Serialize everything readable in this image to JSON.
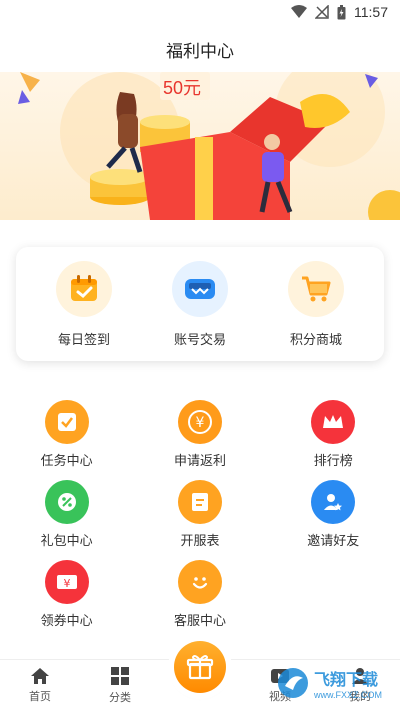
{
  "status_bar": {
    "time": "11:57"
  },
  "header": {
    "title": "福利中心"
  },
  "banner": {
    "tag_text": "50元"
  },
  "features": [
    {
      "label": "每日签到",
      "icon": "calendar-check-icon"
    },
    {
      "label": "账号交易",
      "icon": "account-trade-icon"
    },
    {
      "label": "积分商城",
      "icon": "shopping-cart-icon"
    }
  ],
  "grid": [
    {
      "label": "任务中心",
      "icon": "task-check-icon",
      "color": "#ffa321"
    },
    {
      "label": "申请返利",
      "icon": "yen-coin-icon",
      "color": "#ff9b1a"
    },
    {
      "label": "排行榜",
      "icon": "crown-icon",
      "color": "#f5333b"
    },
    {
      "label": "礼包中心",
      "icon": "gift-percent-icon",
      "color": "#39c35a"
    },
    {
      "label": "开服表",
      "icon": "server-list-icon",
      "color": "#ffa321"
    },
    {
      "label": "邀请好友",
      "icon": "invite-user-icon",
      "color": "#2a8bf2"
    },
    {
      "label": "领券中心",
      "icon": "coupon-yen-icon",
      "color": "#f5333b"
    },
    {
      "label": "客服中心",
      "icon": "smile-face-icon",
      "color": "#ffa321"
    }
  ],
  "bottom_nav": [
    {
      "label": "首页",
      "icon": "home-icon"
    },
    {
      "label": "分类",
      "icon": "category-grid-icon"
    },
    {
      "label": "",
      "icon": "gift-icon"
    },
    {
      "label": "视频",
      "icon": "video-icon"
    },
    {
      "label": "我的",
      "icon": "profile-icon"
    }
  ],
  "watermark": {
    "text": "飞翔下载",
    "sub": "www.FXXZ.COM"
  }
}
